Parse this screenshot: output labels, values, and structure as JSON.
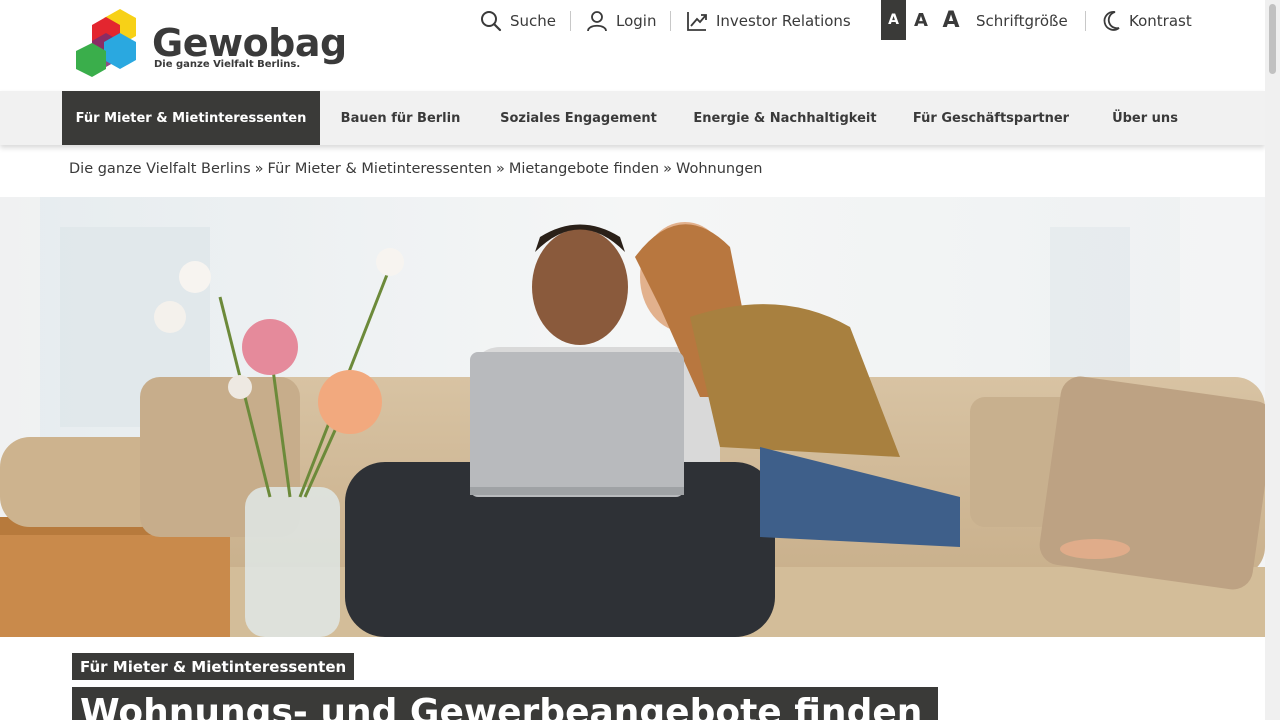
{
  "brand": {
    "name": "Gewobag",
    "tagline": "Die ganze Vielfalt Berlins.",
    "colors": {
      "yellow": "#f7d117",
      "red": "#e3262f",
      "purple": "#7b2e6f",
      "blue": "#2aa8e0",
      "green": "#3aae4b"
    }
  },
  "utility": {
    "search_label": "Suche",
    "login_label": "Login",
    "investor_label": "Investor Relations",
    "font_small": "A",
    "font_medium": "A",
    "font_large": "A",
    "font_size_label": "Schriftgröße",
    "contrast_label": "Kontrast"
  },
  "nav": {
    "items": [
      {
        "label": "Für Mieter & Mietinteressenten",
        "active": true
      },
      {
        "label": "Bauen für Berlin"
      },
      {
        "label": "Soziales Engagement"
      },
      {
        "label": "Energie & Nachhaltigkeit"
      },
      {
        "label": "Für Geschäftspartner"
      },
      {
        "label": "Über uns"
      }
    ]
  },
  "breadcrumb": {
    "items": [
      "Die ganze Vielfalt Berlins",
      "Für Mieter & Mietinteressenten",
      "Mietangebote finden",
      "Wohnungen"
    ],
    "separator": "»"
  },
  "hero": {
    "image_name": "couple-on-sofa-with-laptop"
  },
  "content": {
    "kicker": "Für Mieter & Mietinteressenten",
    "headline": "Wohnungs- und Gewerbeangebote finden"
  },
  "colors": {
    "dark": "#3a3a38",
    "nav_bg": "#f1f1f1",
    "text": "#3a3a3a"
  }
}
